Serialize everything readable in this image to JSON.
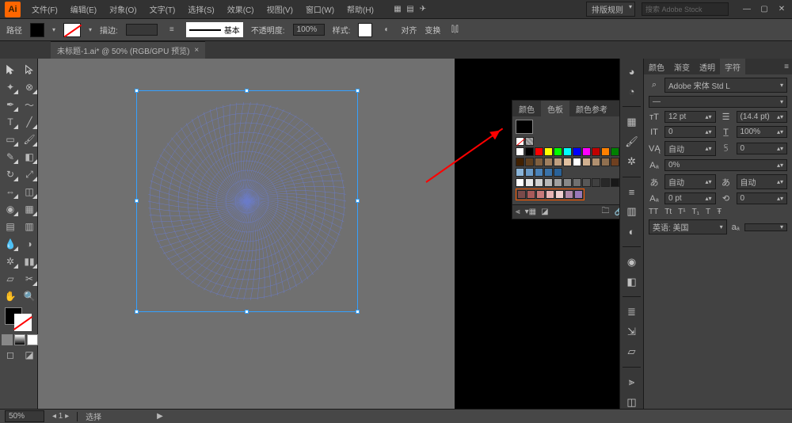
{
  "app": {
    "logo_text": "Ai"
  },
  "menu": {
    "items": [
      "文件(F)",
      "编辑(E)",
      "对象(O)",
      "文字(T)",
      "选择(S)",
      "效果(C)",
      "视图(V)",
      "窗口(W)",
      "帮助(H)"
    ]
  },
  "menubar_right": {
    "workspace": "排版规则",
    "search_placeholder": "搜索 Adobe Stock"
  },
  "controlbar": {
    "label_path": "路径",
    "stroke_label": "描边:",
    "brush_preset": "基本",
    "opacity_label": "不透明度:",
    "opacity_value": "100%",
    "style_label": "样式:",
    "align_label": "对齐",
    "transform_label": "变换"
  },
  "document": {
    "tab_title": "未标题-1.ai* @ 50% (RGB/GPU 预览)"
  },
  "tools": {
    "list": [
      "selection",
      "direct-selection",
      "magic-wand",
      "lasso",
      "pen",
      "curvature",
      "type",
      "line",
      "rectangle",
      "paintbrush",
      "pencil",
      "eraser",
      "rotate",
      "scale",
      "width",
      "free-transform",
      "shape-builder",
      "perspective",
      "mesh",
      "gradient",
      "eyedropper",
      "blend",
      "symbol-sprayer",
      "column-graph",
      "artboard",
      "slice",
      "hand",
      "zoom"
    ]
  },
  "float_panel": {
    "tabs": [
      "颜色",
      "色板",
      "颜色参考"
    ],
    "active_tab": "色板",
    "footer_icons": [
      "folder",
      "link",
      "new-swatch",
      "delete"
    ]
  },
  "swatch_colors": {
    "row2": [
      "#ffffff",
      "#000000",
      "#ff0000",
      "#ffff00",
      "#00ff00",
      "#00ffff",
      "#0000ff",
      "#ff00ff",
      "#c00000",
      "#ff8000",
      "#008000",
      "#004080",
      "#800080",
      "#ff96c8"
    ],
    "row3": [
      "#402000",
      "#604020",
      "#806040",
      "#a08060",
      "#c0a080",
      "#e0c0a0",
      "#ffffff",
      "#d0b090",
      "#b09070",
      "#907050",
      "#704020",
      "#502000",
      "#301000",
      "#ffe0c0"
    ],
    "row4": [
      "#8ab4d8",
      "#6a9bc8",
      "#4a82b8",
      "#3a72a8",
      "#2a6298"
    ],
    "gray_row": [
      "#ffffff",
      "#e8e8e8",
      "#d0d0d0",
      "#b8b8b8",
      "#a0a0a0",
      "#888888",
      "#707070",
      "#585858",
      "#404040",
      "#282828",
      "#181818",
      "#000000"
    ],
    "highlight_row": [
      "#7a4a4a",
      "#a85a5a",
      "#c87a7a",
      "#e8b4b4",
      "#f0d0d0",
      "#b088a8",
      "#9878b8"
    ]
  },
  "dock": {
    "icons": [
      "color",
      "swatches",
      "brushes",
      "symbols",
      "stroke",
      "gradient",
      "transparency",
      "appearance",
      "graphic-styles",
      "layers",
      "artboards",
      "links",
      "align",
      "pathfinder",
      "transform",
      "asset-export"
    ]
  },
  "char": {
    "tabs": [
      "颜色",
      "渐变",
      "透明",
      "字符"
    ],
    "active_tab": "字符",
    "font_search_icon": "⌕",
    "font_name": "Adobe 宋体 Std L",
    "font_style": "—",
    "size_icon": "тT",
    "size_value": "12 pt",
    "leading_icon": "☰",
    "leading_value": "(14.4 pt)",
    "kerning_icon": "VĄ",
    "kerning_value": "0",
    "tracking_icon": "∀",
    "tracking_value": "100%",
    "vscale_icon": "vĄ",
    "vscale_value": "自动",
    "hscale_value": "0",
    "baseline_icon": "Aₐ",
    "baseline_value": "0%",
    "rotate_value": "自动",
    "tsume_value": "自动",
    "ab_value": "0 pt",
    "t_value": "0",
    "caps_row": [
      "TT",
      "Tt",
      "T¹",
      "T₁",
      "T",
      "Ŧ"
    ],
    "lang_label": "英语: 美国",
    "aa_label": "aₐ"
  },
  "status": {
    "zoom": "50%",
    "nav": "◂ 1 ▸",
    "mode_label": "选择"
  }
}
